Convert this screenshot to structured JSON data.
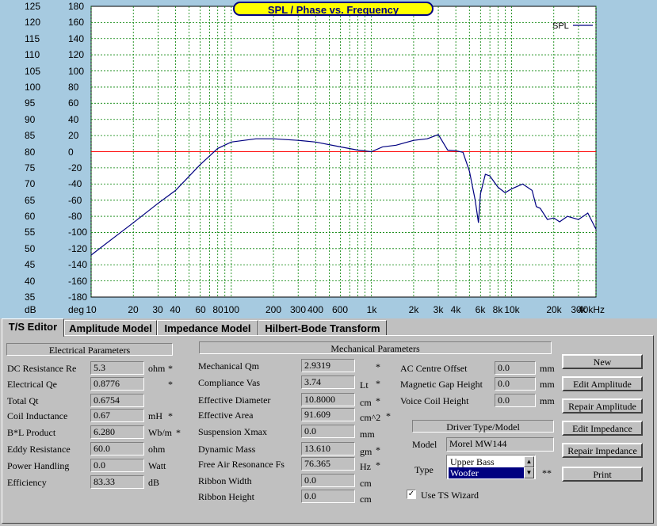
{
  "chart": {
    "title": "SPL / Phase vs. Frequency",
    "legend": "SPL",
    "y_spl_labels": [
      "125",
      "120",
      "115",
      "110",
      "105",
      "100",
      "95",
      "90",
      "85",
      "80",
      "75",
      "70",
      "65",
      "60",
      "55",
      "50",
      "45",
      "40",
      "35"
    ],
    "y_phase_labels": [
      "180",
      "160",
      "140",
      "120",
      "100",
      "80",
      "60",
      "40",
      "20",
      "0",
      "-20",
      "-40",
      "-60",
      "-80",
      "-100",
      "-120",
      "-140",
      "-160",
      "-180"
    ],
    "y_unit_spl": "dB",
    "y_unit_phase": "deg",
    "x_labels": [
      "10",
      "20",
      "30",
      "40",
      "60",
      "80",
      "100",
      "200",
      "300",
      "400",
      "600",
      "1k",
      "2k",
      "3k",
      "4k",
      "6k",
      "8k",
      "10k",
      "20k",
      "30k",
      "40kHz"
    ],
    "colors": {
      "plot_bg": "#ffffff",
      "grid": "#008000",
      "spl": "#000080",
      "phase_zero": "#ff0000",
      "title_bg": "#ffff00",
      "frame": "#a6cae0"
    }
  },
  "chart_data": {
    "type": "line",
    "title": "SPL / Phase vs. Frequency",
    "xlabel": "",
    "ylabel": "",
    "x_scale": "log",
    "xlim": [
      10,
      40000
    ],
    "ylim": [
      35,
      125
    ],
    "ylim_phase": [
      -180,
      180
    ],
    "grid": true,
    "legend_position": "top-right",
    "series": [
      {
        "name": "SPL",
        "x": [
          10,
          20,
          30,
          40,
          60,
          80,
          100,
          150,
          200,
          300,
          400,
          600,
          800,
          1000,
          1200,
          1500,
          2000,
          2500,
          3000,
          3500,
          4000,
          4500,
          5000,
          5500,
          5800,
          6000,
          6500,
          7000,
          8000,
          9000,
          10000,
          12000,
          14000,
          15000,
          16000,
          18000,
          20000,
          22000,
          25000,
          30000,
          35000,
          40000
        ],
        "y": [
          48,
          58,
          64,
          68,
          76,
          81,
          83,
          84,
          84,
          83.5,
          83,
          81.5,
          80.5,
          80,
          81.5,
          82,
          83.5,
          84,
          85.3,
          80.5,
          80.3,
          79.8,
          74,
          65,
          58,
          67,
          73,
          72.5,
          69,
          67.3,
          68.5,
          70,
          68,
          63,
          62.5,
          59,
          59.5,
          58.3,
          60,
          59,
          61,
          56
        ]
      }
    ],
    "reference_lines": [
      {
        "axis": "phase",
        "value": 0
      }
    ]
  },
  "tabs": [
    {
      "label": "T/S Editor",
      "active": true
    },
    {
      "label": "Amplitude Model"
    },
    {
      "label": "Impedance Model"
    },
    {
      "label": "Hilbert-Bode Transform"
    }
  ],
  "electrical": {
    "header": "Electrical Parameters",
    "rows": [
      {
        "label": "DC Resistance Re",
        "value": "5.3",
        "unit": "ohm",
        "mark": "*"
      },
      {
        "label": "Electrical Qe",
        "value": "0.8776",
        "unit": "",
        "mark": "*"
      },
      {
        "label": "Total Qt",
        "value": "0.6754",
        "unit": "",
        "mark": ""
      },
      {
        "label": "Coil Inductance",
        "value": "0.67",
        "unit": "mH",
        "mark": "*"
      },
      {
        "label": "B*L Product",
        "value": "6.280",
        "unit": "Wb/m",
        "mark": "*"
      },
      {
        "label": "Eddy Resistance",
        "value": "60.0",
        "unit": "ohm",
        "mark": ""
      },
      {
        "label": "Power Handling",
        "value": "0.0",
        "unit": "Watt",
        "mark": ""
      },
      {
        "label": "Efficiency",
        "value": "83.33",
        "unit": "dB",
        "mark": ""
      }
    ]
  },
  "mechanical": {
    "header": "Mechanical Parameters",
    "rows": [
      {
        "label": "Mechanical Qm",
        "value": "2.9319",
        "unit": "",
        "mark": "*"
      },
      {
        "label": "Compliance Vas",
        "value": "3.74",
        "unit": "Lt",
        "mark": "*"
      },
      {
        "label": "Effective Diameter",
        "value": "10.8000",
        "unit": "cm",
        "mark": "*"
      },
      {
        "label": "Effective Area",
        "value": "91.609",
        "unit": "cm^2",
        "mark": "*"
      },
      {
        "label": "Suspension Xmax",
        "value": "0.0",
        "unit": "mm",
        "mark": ""
      },
      {
        "label": "Dynamic Mass",
        "value": "13.610",
        "unit": "gm",
        "mark": "*"
      },
      {
        "label": "Free Air Resonance Fs",
        "value": "76.365",
        "unit": "Hz",
        "mark": "*"
      },
      {
        "label": "Ribbon Width",
        "value": "0.0",
        "unit": "cm",
        "mark": ""
      },
      {
        "label": "Ribbon Height",
        "value": "0.0",
        "unit": "cm",
        "mark": ""
      }
    ]
  },
  "extra": {
    "rows": [
      {
        "label": "AC Centre Offset",
        "value": "0.0",
        "unit": "mm"
      },
      {
        "label": "Magnetic Gap Height",
        "value": "0.0",
        "unit": "mm"
      },
      {
        "label": "Voice Coil Height",
        "value": "0.0",
        "unit": "mm"
      }
    ]
  },
  "driver": {
    "header": "Driver Type/Model",
    "model_label": "Model",
    "model_value": "Morel MW144",
    "type_label": "Type",
    "type_options": [
      "Upper Bass",
      "Woofer"
    ],
    "type_selected": "Woofer",
    "type_mark": "**",
    "wizard_label": "Use TS Wizard",
    "wizard_checked": true
  },
  "buttons": [
    "New",
    "Edit Amplitude",
    "Repair Amplitude",
    "Edit Impedance",
    "Repair Impedance",
    "Print"
  ]
}
